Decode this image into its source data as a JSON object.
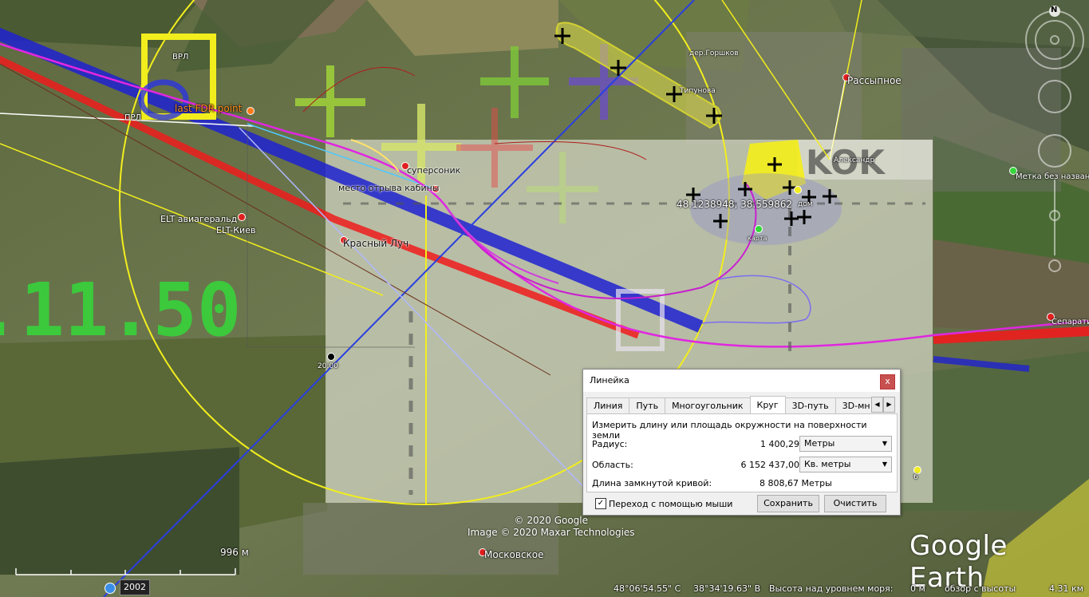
{
  "map_labels": {
    "vrl": "ВРЛ",
    "last_fdr": "last FDR point",
    "prl": "ПРЛ",
    "supersonic": "суперсоник",
    "cabin_tear": "место отрыва кабины",
    "elt_avia": "ELT авиагеральд",
    "elt_kiev": "ELT-Киев",
    "krasny_luch": "Красный Луч",
    "gorshkov": "дер.Горшков",
    "tipunova": "Типунова",
    "rassypnoe": "Рассыпное",
    "alexandr": "Александр",
    "no_name": "Метка без названия",
    "coords": "48.1238948, 38.559862",
    "dom": "дом",
    "karta": "карта",
    "separat": "Сепарати",
    "time_2000": "20:00",
    "moskovskoe": "Московское",
    "six": "6",
    "big_green": ".11.50",
    "kok": "KOK"
  },
  "ruler": {
    "title": "Линейка",
    "close": "x",
    "tabs": [
      "Линия",
      "Путь",
      "Многоугольник",
      "Круг",
      "3D-путь",
      "3D-мн"
    ],
    "active_tab": 3,
    "description": "Измерить длину или площадь окружности на поверхности земли",
    "radius_label": "Радиус:",
    "radius_value": "1 400,29",
    "radius_unit": "Метры",
    "area_label": "Область:",
    "area_value": "6 152 437,00",
    "area_unit": "Кв. метры",
    "perimeter_label": "Длина замкнутой кривой:",
    "perimeter_value": "8 808,67 Метры",
    "mouse_nav_label": "Переход с помощью мыши",
    "mouse_nav_checked": true,
    "save_button": "Сохранить",
    "clear_button": "Очистить"
  },
  "copyright": {
    "line1": "© 2020 Google",
    "line2": "Image © 2020 Maxar Technologies"
  },
  "logo": "Google Earth",
  "scale": {
    "label": "996 м"
  },
  "status": {
    "year": "2002",
    "lat": "48°06'54.55\" С",
    "lon": "38°34'19.63\" В",
    "elev_label": "Высота над уровнем моря:",
    "elev_value": "0 м",
    "eye_label": "обзор с высоты",
    "eye_value": "4.31 км"
  },
  "compass": {
    "north": "N"
  },
  "colors": {
    "yellow": "#f2ee1d",
    "magenta": "#e027e0",
    "red": "#ee1c1c",
    "blue": "#1f22d0",
    "green": "#35d83a"
  }
}
